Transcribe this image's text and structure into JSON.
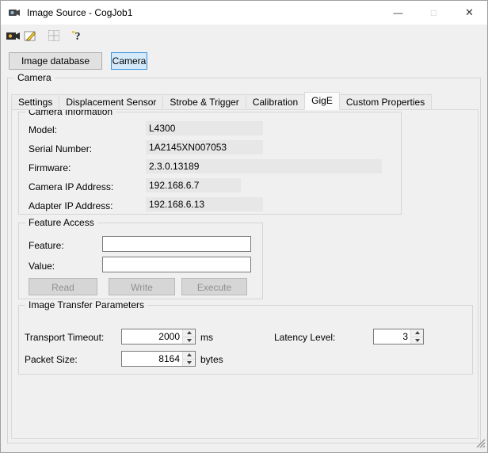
{
  "window": {
    "title": "Image Source - CogJob1",
    "minimize_glyph": "—",
    "maximize_glyph": "□",
    "close_glyph": "✕"
  },
  "toolbar": {
    "icons": [
      "acquire-image-icon",
      "edit-acquisition-icon",
      "grid-fixture-icon",
      "help-icon"
    ]
  },
  "source_selector": {
    "image_database_label": "Image database",
    "camera_label": "Camera"
  },
  "camera_group_label": "Camera",
  "tabs": {
    "items": [
      "Settings",
      "Displacement Sensor",
      "Strobe & Trigger",
      "Calibration",
      "GigE",
      "Custom Properties"
    ],
    "active": "GigE"
  },
  "camera_information": {
    "label": "Camera Information",
    "fields": [
      {
        "label": "Model:",
        "value": "L4300"
      },
      {
        "label": "Serial Number:",
        "value": "1A2145XN007053"
      },
      {
        "label": "Firmware:",
        "value": "2.3.0.13189"
      },
      {
        "label": "Camera IP Address:",
        "value": "192.168.6.7"
      },
      {
        "label": "Adapter IP Address:",
        "value": "192.168.6.13"
      }
    ]
  },
  "feature_access": {
    "label": "Feature Access",
    "feature_label": "Feature:",
    "feature_value": "",
    "value_label": "Value:",
    "value_value": "",
    "read_label": "Read",
    "write_label": "Write",
    "execute_label": "Execute"
  },
  "image_transfer": {
    "label": "Image Transfer Parameters",
    "transport_timeout_label": "Transport Timeout:",
    "transport_timeout_value": "2000",
    "transport_timeout_unit": "ms",
    "latency_level_label": "Latency Level:",
    "latency_level_value": "3",
    "packet_size_label": "Packet Size:",
    "packet_size_value": "8164",
    "packet_size_unit": "bytes"
  }
}
